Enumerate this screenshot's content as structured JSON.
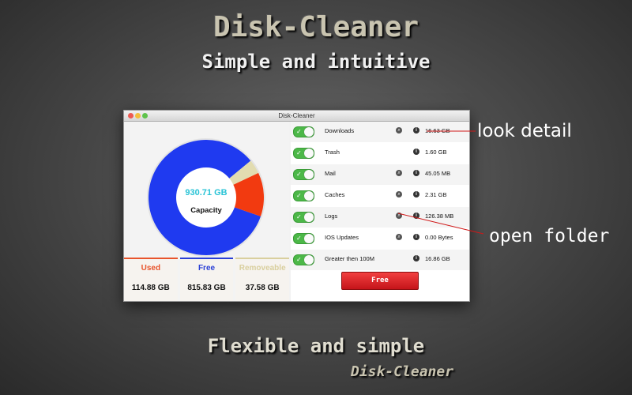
{
  "promo": {
    "title": "Disk-Cleaner",
    "subtitle": "Simple and intuitive",
    "bottom_tagline": "Flexible and simple",
    "brand": "Disk-Cleaner"
  },
  "window": {
    "title": "Disk-Cleaner"
  },
  "capacity": {
    "total": "930.71 GB",
    "label": "Capacity",
    "used_fraction": 0.123,
    "removeable_fraction": 0.04,
    "colors": {
      "used": "#f23a10",
      "free": "#1f3af0",
      "removeable": "#e2dcb0"
    }
  },
  "stats": [
    {
      "label": "Used",
      "value": "114.88 GB",
      "color": "#e8542c"
    },
    {
      "label": "Free",
      "value": "815.83 GB",
      "color": "#2a3fd6"
    },
    {
      "label": "Removeable",
      "value": "37.58 GB",
      "color": "#d9cf9e"
    }
  ],
  "items": [
    {
      "label": "Downloads",
      "size": "16.63 GB",
      "enabled": true,
      "folder_icon": true
    },
    {
      "label": "Trash",
      "size": "1.60 GB",
      "enabled": true,
      "folder_icon": false
    },
    {
      "label": "Mail",
      "size": "45.05 MB",
      "enabled": true,
      "folder_icon": true
    },
    {
      "label": "Caches",
      "size": "2.31 GB",
      "enabled": true,
      "folder_icon": true
    },
    {
      "label": "Logs",
      "size": "126.38 MB",
      "enabled": true,
      "folder_icon": true
    },
    {
      "label": "IOS Updates",
      "size": "0.00 Bytes",
      "enabled": true,
      "folder_icon": true
    },
    {
      "label": "Greater then 100M",
      "size": "16.86 GB",
      "enabled": true,
      "folder_icon": false
    }
  ],
  "free_button": "Free",
  "annotations": {
    "look_detail": "look detail",
    "open_folder": "open folder"
  }
}
